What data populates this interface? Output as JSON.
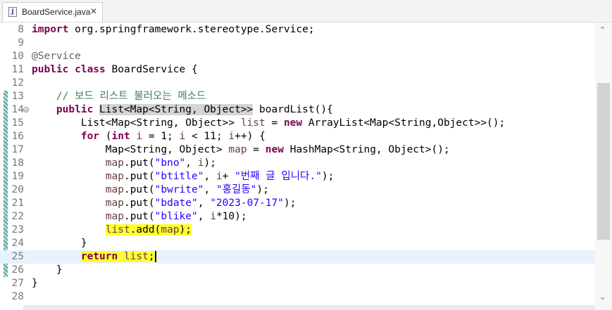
{
  "tab": {
    "title": "BoardService.java",
    "close": "✕",
    "icon": "J"
  },
  "scrollbar": {
    "up": "⌃",
    "down": "⌄"
  },
  "lines": [
    {
      "n": "8"
    },
    {
      "n": "9"
    },
    {
      "n": "10"
    },
    {
      "n": "11"
    },
    {
      "n": "12"
    },
    {
      "n": "13"
    },
    {
      "n": "14"
    },
    {
      "n": "15"
    },
    {
      "n": "16"
    },
    {
      "n": "17"
    },
    {
      "n": "18"
    },
    {
      "n": "19"
    },
    {
      "n": "20"
    },
    {
      "n": "21"
    },
    {
      "n": "22"
    },
    {
      "n": "23"
    },
    {
      "n": "24"
    },
    {
      "n": "25"
    },
    {
      "n": "26"
    },
    {
      "n": "27"
    },
    {
      "n": "28"
    }
  ],
  "code": {
    "l8_kw": "import",
    "l8_rest": " org.springframework.stereotype.Service;",
    "l10_ann": "@Service",
    "l11_kw": "public class",
    "l11_rest": " BoardService {",
    "l13_cmt": "// 보드 리스트 불러오는 메소드",
    "l14_kw": "public",
    "l14_type": "List<Map<String, Object>>",
    "l14_rest": " boardList(){",
    "l15_a": "List<Map<String, Object>> ",
    "l15_var": "list",
    "l15_b": " = ",
    "l15_kw": "new",
    "l15_c": " ArrayList<Map<String,Object>>();",
    "l16_kw": "for",
    "l16_a": " (",
    "l16_kw2": "int",
    "l16_b": " ",
    "l16_i1": "i",
    "l16_c": " = 1; ",
    "l16_i2": "i",
    "l16_d": " < 11; ",
    "l16_i3": "i",
    "l16_e": "++) {",
    "l17_a": "Map<String, Object> ",
    "l17_var": "map",
    "l17_b": " = ",
    "l17_kw": "new",
    "l17_c": " HashMap<String, Object>();",
    "l18_map": "map",
    "l18_a": ".put(",
    "l18_str": "\"bno\"",
    "l18_b": ", ",
    "l18_i": "i",
    "l18_c": ");",
    "l19_map": "map",
    "l19_a": ".put(",
    "l19_str": "\"btitle\"",
    "l19_b": ", ",
    "l19_i": "i",
    "l19_c": "+ ",
    "l19_str2": "\"번째 글 입니다.\"",
    "l19_d": ");",
    "l20_map": "map",
    "l20_a": ".put(",
    "l20_str": "\"bwrite\"",
    "l20_b": ", ",
    "l20_str2": "\"홍길동\"",
    "l20_c": ");",
    "l21_map": "map",
    "l21_a": ".put(",
    "l21_str": "\"bdate\"",
    "l21_b": ", ",
    "l21_str2": "\"2023-07-17\"",
    "l21_c": ");",
    "l22_map": "map",
    "l22_a": ".put(",
    "l22_str": "\"blike\"",
    "l22_b": ", ",
    "l22_i": "i",
    "l22_c": "*10);",
    "l23_list": "list",
    "l23_a": ".add(",
    "l23_map": "map",
    "l23_b": ");",
    "l24": "}",
    "l25_kw": "return",
    "l25_a": " ",
    "l25_list": "list",
    "l25_b": ";",
    "l26": "}",
    "l27": "}"
  }
}
